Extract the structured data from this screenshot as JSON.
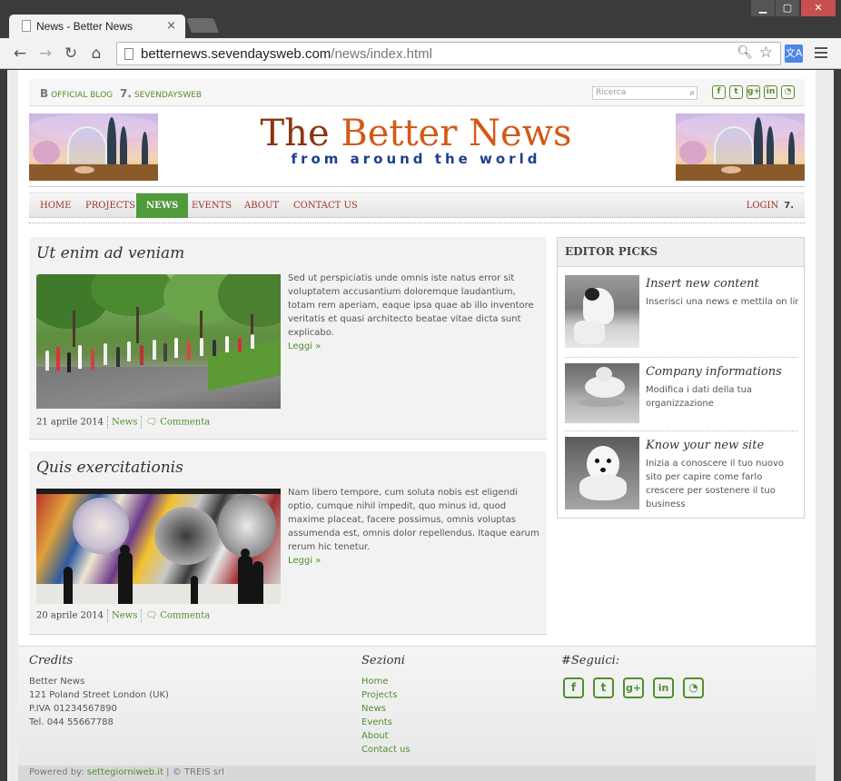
{
  "browser": {
    "tab_title": "News - Better News",
    "tab_close": "×",
    "url_host": "betternews.sevendaysweb.com",
    "url_path": "/news/index.html",
    "window_controls": {
      "minimize": "▁",
      "maximize": "▢",
      "close": "✕"
    },
    "translate_label": "文A"
  },
  "topbar": {
    "official_blog": "OFFICIAL BLOG",
    "sevendaysweb": "SEVENDAYSWEB",
    "search_placeholder": "Ricerca",
    "social": [
      "f",
      "t",
      "g+",
      "in",
      "rss"
    ]
  },
  "banner": {
    "title_part1": "The ",
    "title_part2": "Better News",
    "subtitle": "from around the world"
  },
  "nav": {
    "items": [
      {
        "label": "HOME",
        "active": false
      },
      {
        "label": "PROJECTS",
        "active": false
      },
      {
        "label": "NEWS",
        "active": true
      },
      {
        "label": "EVENTS",
        "active": false
      },
      {
        "label": "ABOUT",
        "active": false
      },
      {
        "label": "CONTACT US",
        "active": false
      }
    ],
    "login": "LOGIN",
    "login_mark": "7."
  },
  "articles": [
    {
      "title": "Ut enim ad veniam",
      "body": "Sed ut perspiciatis unde omnis iste natus error sit voluptatem accusantium doloremque laudantium, totam rem aperiam, eaque ipsa quae ab illo inventore veritatis et quasi architecto beatae vitae dicta sunt explicabo.",
      "more": "Leggi »",
      "date": "21 aprile 2014",
      "category": "News",
      "comment": "Commenta"
    },
    {
      "title": "Quis exercitationis",
      "body": "Nam libero tempore, cum soluta nobis est eligendi optio, cumque nihil impedit, quo minus id, quod maxime placeat, facere possimus, omnis voluptas assumenda est, omnis dolor repellendus. Itaque earum rerum hic tenetur.",
      "more": "Leggi »",
      "date": "20 aprile 2014",
      "category": "News",
      "comment": "Commenta"
    }
  ],
  "editor_picks": {
    "heading": "EDITOR PICKS",
    "items": [
      {
        "title": "Insert new content",
        "text": "Inserisci una news e mettila on line"
      },
      {
        "title": "Company informations",
        "text": "Modifica i dati della tua organizzazione"
      },
      {
        "title": "Know your new site",
        "text": "Inizia a conoscere il tuo nuovo sito per capire come farlo crescere per sostenere il tuo business"
      }
    ]
  },
  "footer": {
    "credits_heading": "Credits",
    "credits_lines": [
      "Better News",
      "121 Poland Street London (UK)",
      "P.IVA 01234567890",
      "Tel. 044 55667788"
    ],
    "sections_heading": "Sezioni",
    "sections": [
      "Home",
      "Projects",
      "News",
      "Events",
      "About",
      "Contact us"
    ],
    "follow_heading": "#Seguici:",
    "social": [
      "f",
      "t",
      "g+",
      "in",
      "rss"
    ],
    "powered_prefix": "Powered by: ",
    "powered_link": "settegiorniweb.it",
    "powered_suffix": " | © TREIS srl"
  }
}
